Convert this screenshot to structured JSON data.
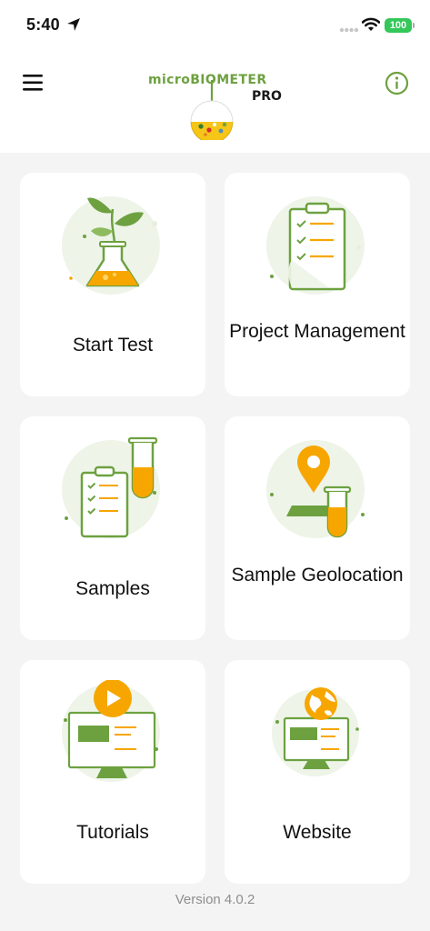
{
  "status_bar": {
    "time": "5:40",
    "battery": "100",
    "icons": [
      "location-arrow-icon",
      "signal-dots-icon",
      "wifi-icon",
      "battery-icon"
    ]
  },
  "header": {
    "logo_text": "microBIOMETER",
    "logo_sub": "PRO",
    "menu_icon": "hamburger-menu-icon",
    "info_icon": "info-icon"
  },
  "tiles": [
    {
      "label": "Start Test",
      "icon": "flask-plant-icon"
    },
    {
      "label": "Project Management",
      "icon": "clipboard-checklist-icon"
    },
    {
      "label": "Samples",
      "icon": "clipboard-test-tube-icon"
    },
    {
      "label": "Sample Geolocation",
      "icon": "map-pin-test-tube-icon"
    },
    {
      "label": "Tutorials",
      "icon": "monitor-play-icon"
    },
    {
      "label": "Website",
      "icon": "monitor-globe-icon"
    }
  ],
  "footer": {
    "version": "Version 4.0.2"
  },
  "colors": {
    "brand_green": "#6da140",
    "accent_orange": "#f7a600",
    "background": "#f3f4f3",
    "card": "#ffffff"
  }
}
